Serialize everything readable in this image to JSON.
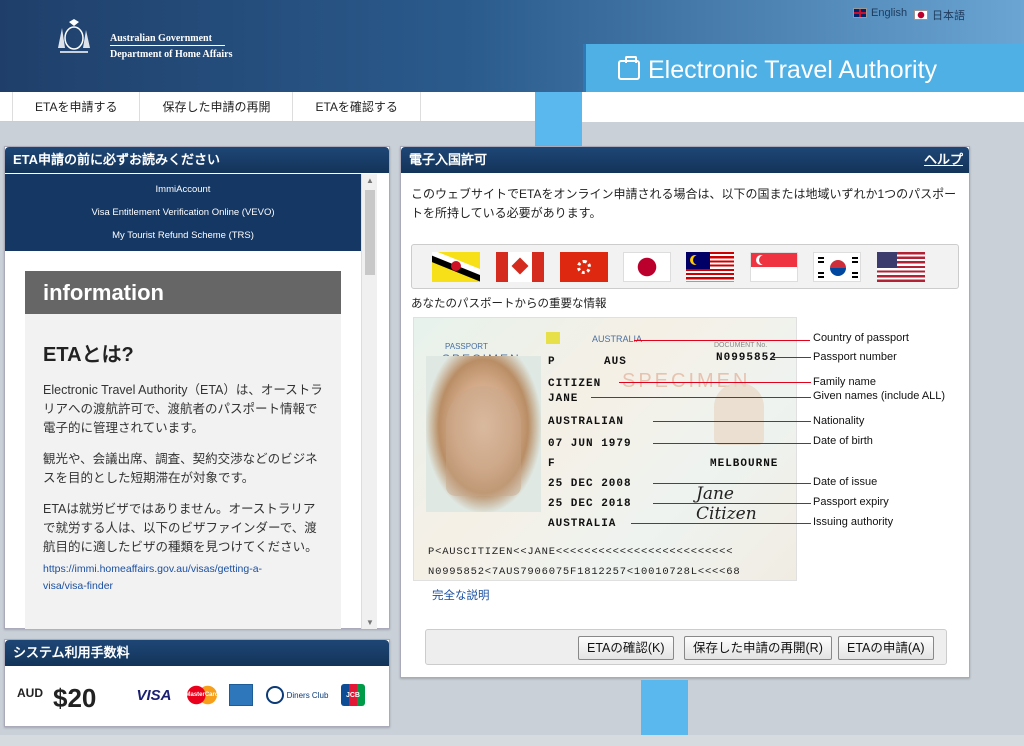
{
  "header": {
    "gov_line1": "Australian Government",
    "gov_line2": "Department of Home Affairs",
    "app_title": "Electronic Travel Authority",
    "lang_en": "English",
    "lang_ja": "日本語"
  },
  "nav": {
    "items": [
      {
        "label": "ETAを申請する"
      },
      {
        "label": "保存した申請の再開"
      },
      {
        "label": "ETAを確認する"
      }
    ]
  },
  "left_panel": {
    "title": "ETA申請の前に必ずお読みください",
    "links": [
      "ImmiAccount",
      "Visa Entitlement Verification Online (VEVO)",
      "My Tourist Refund Scheme (TRS)"
    ],
    "info_title": "information",
    "info_heading": "ETAとは?",
    "para1": "Electronic Travel Authority（ETA）は、オーストラリアへの渡航許可で、渡航者のパスポート情報で電子的に管理されています。",
    "para2": "観光や、会議出席、調査、契約交渉などのビジネスを目的とした短期滞在が対象です。",
    "para3": "ETAは就労ビザではありません。オーストラリアで就労する人は、以下のビザファインダーで、渡航目的に適したビザの種類を見つけてください。",
    "link_line1": "https://immi.homeaffairs.gov.au/visas/getting-a-",
    "link_line2": "visa/visa-finder"
  },
  "fee_panel": {
    "title": "システム利用手数料",
    "currency": "AUD",
    "amount": "$20",
    "cards": [
      "VISA",
      "MasterCard",
      "American Express",
      "Diners Club International",
      "JCB"
    ],
    "card_labels": {
      "visa": "VISA",
      "master": "MasterCard",
      "diners": "Diners Club",
      "jcb": "JCB"
    }
  },
  "right_panel": {
    "title": "電子入国許可",
    "help": "ヘルプ",
    "intro": "このウェブサイトでETAをオンライン申請される場合は、以下の国または地域いずれか1つのパスポートを所持している必要があります。",
    "flags": [
      "brunei",
      "canada",
      "hong-kong",
      "japan",
      "malaysia",
      "singapore",
      "south-korea",
      "usa"
    ],
    "passport_label": "あなたのパスポートからの重要な情報",
    "full_link": "完全な説明",
    "passport": {
      "header_passport": "PASSPORT",
      "specimen": "SPECIMEN",
      "country": "AUSTRALIA",
      "type": "P",
      "code": "AUS",
      "doc_no": "N0995852",
      "surname": "CITIZEN",
      "given": "JANE",
      "nationality": "AUSTRALIAN",
      "dob": "07 JUN 1979",
      "sex": "F",
      "place": "MELBOURNE",
      "issue": "25 DEC 2008",
      "expiry": "25 DEC 2018",
      "authority": "AUSTRALIA",
      "signature": "Jane Citizen",
      "mrz1": "P<AUSCITIZEN<<JANE<<<<<<<<<<<<<<<<<<<<<<<<<",
      "mrz2": "N0995852<7AUS7906075F1812257<10010728L<<<<68",
      "lbl_document_no": "DOCUMENT No."
    },
    "callouts": [
      "Country of passport",
      "Passport number",
      "Family name",
      "Given names (include ALL)",
      "Nationality",
      "Date of birth",
      "Date of issue",
      "Passport expiry",
      "Issuing authority"
    ],
    "buttons": {
      "check": "ETAの確認(K)",
      "resume": "保存した申請の再開(R)",
      "apply": "ETAの申請(A)"
    }
  }
}
